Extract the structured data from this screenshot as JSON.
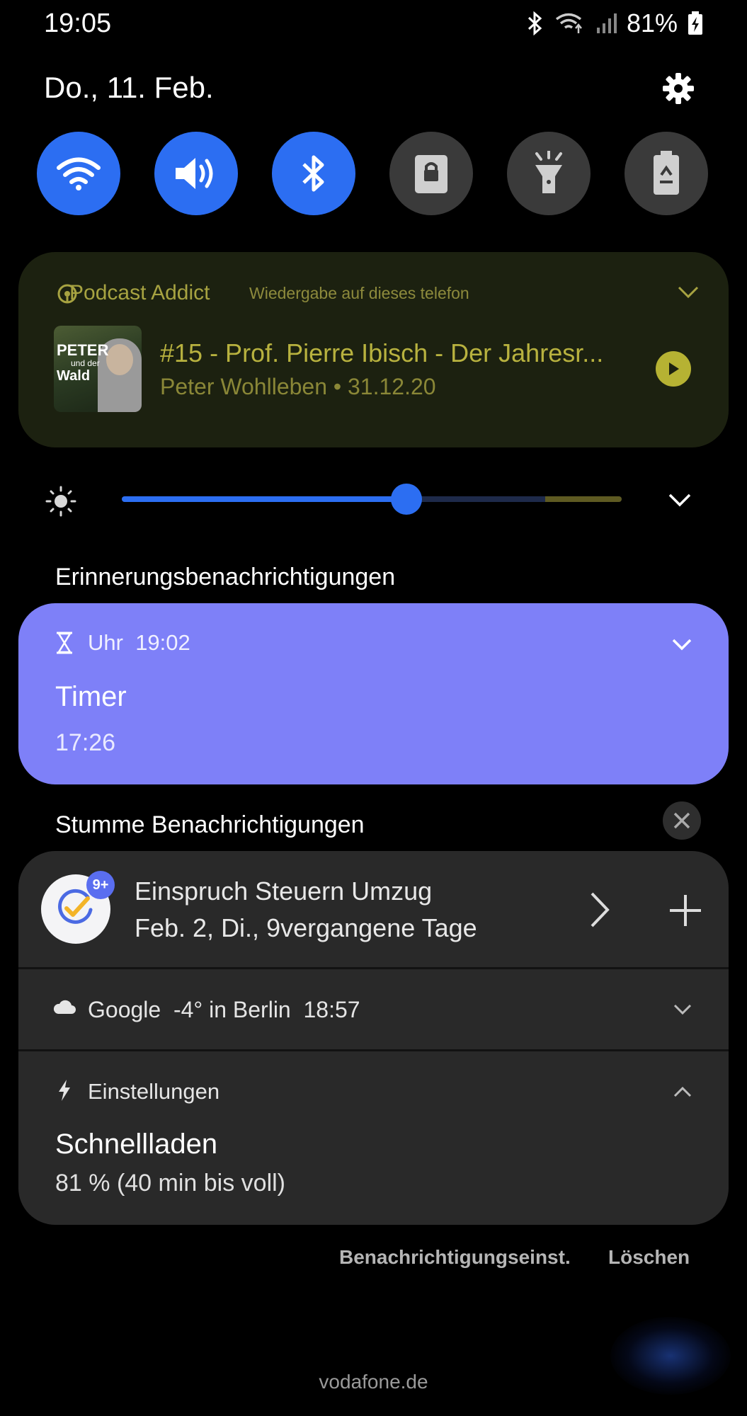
{
  "status_bar": {
    "time": "19:05",
    "battery": "81%",
    "icons": [
      "bluetooth-icon",
      "wifi-calling-icon",
      "signal-icon",
      "battery-charging-icon"
    ]
  },
  "header": {
    "date": "Do., 11. Feb."
  },
  "quick_toggles": [
    {
      "name": "wifi",
      "icon": "wifi-icon",
      "state": "on"
    },
    {
      "name": "sound",
      "icon": "speaker-icon",
      "state": "on"
    },
    {
      "name": "bluetooth",
      "icon": "bluetooth-icon",
      "state": "on"
    },
    {
      "name": "screen-lock",
      "icon": "lock-icon",
      "state": "off"
    },
    {
      "name": "flashlight",
      "icon": "flashlight-icon",
      "state": "off"
    },
    {
      "name": "power-saving",
      "icon": "battery-recycle-icon",
      "state": "off"
    }
  ],
  "media": {
    "app": "Podcast Addict",
    "output": "Wiedergabe auf dieses telefon",
    "artwork_text_1": "PETER",
    "artwork_text_2": "und der",
    "artwork_text_3": "Wald",
    "title": "#15 - Prof. Pierre Ibisch - Der Jahresr...",
    "subtitle": "Peter Wohlleben • 31.12.20",
    "accent": "#b6b233"
  },
  "brightness": {
    "level": 0.57,
    "accent": "#2c6ef2"
  },
  "reminder_section": {
    "label": "Erinnerungsbenachrichtigungen"
  },
  "timer_notification": {
    "app": "Uhr",
    "time": "19:02",
    "title": "Timer",
    "value": "17:26",
    "color": "#7e80f8"
  },
  "silent_section": {
    "label": "Stumme Benachrichtigungen"
  },
  "todo_notification": {
    "badge": "9+",
    "title": "Einspruch Steuern Umzug",
    "subtitle": "Feb. 2, Di., 9vergangene Tage"
  },
  "weather_notification": {
    "app": "Google",
    "text": "-4° in Berlin",
    "time": "18:57"
  },
  "charging_notification": {
    "app": "Einstellungen",
    "title": "Schnellladen",
    "subtitle": "81 % (40 min bis voll)"
  },
  "footer": {
    "notification_settings": "Benachrichtigungseinst.",
    "clear": "Löschen",
    "carrier": "vodafone.de"
  }
}
